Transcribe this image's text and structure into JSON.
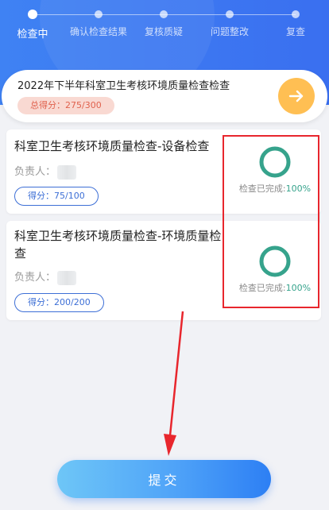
{
  "steps": [
    {
      "label": "检查中",
      "active": true
    },
    {
      "label": "确认检查结果",
      "active": false
    },
    {
      "label": "复核质疑",
      "active": false
    },
    {
      "label": "问题整改",
      "active": false
    },
    {
      "label": "复查",
      "active": false
    }
  ],
  "summary": {
    "title": "2022年下半年科室卫生考核环境质量检查检查",
    "total_score": "总得分：275/300",
    "go_icon": "arrow-right-icon"
  },
  "items": [
    {
      "title": "科室卫生考核环境质量检查-设备检查",
      "owner_label": "负责人：",
      "score": "得分：75/100",
      "progress_label": "检查已完成:",
      "progress_value": "100%",
      "progress": 1.0
    },
    {
      "title": "科室卫生考核环境质量检查-环境质量检查",
      "owner_label": "负责人：",
      "score": "得分：200/200",
      "progress_label": "检查已完成:",
      "progress_value": "100%",
      "progress": 1.0
    }
  ],
  "submit_label": "提交",
  "colors": {
    "header": "#3f82f3",
    "ring": "#36a38c",
    "highlight": "#e8262d",
    "score_badge": "#e0624e",
    "go_button": "#ffbf53"
  }
}
